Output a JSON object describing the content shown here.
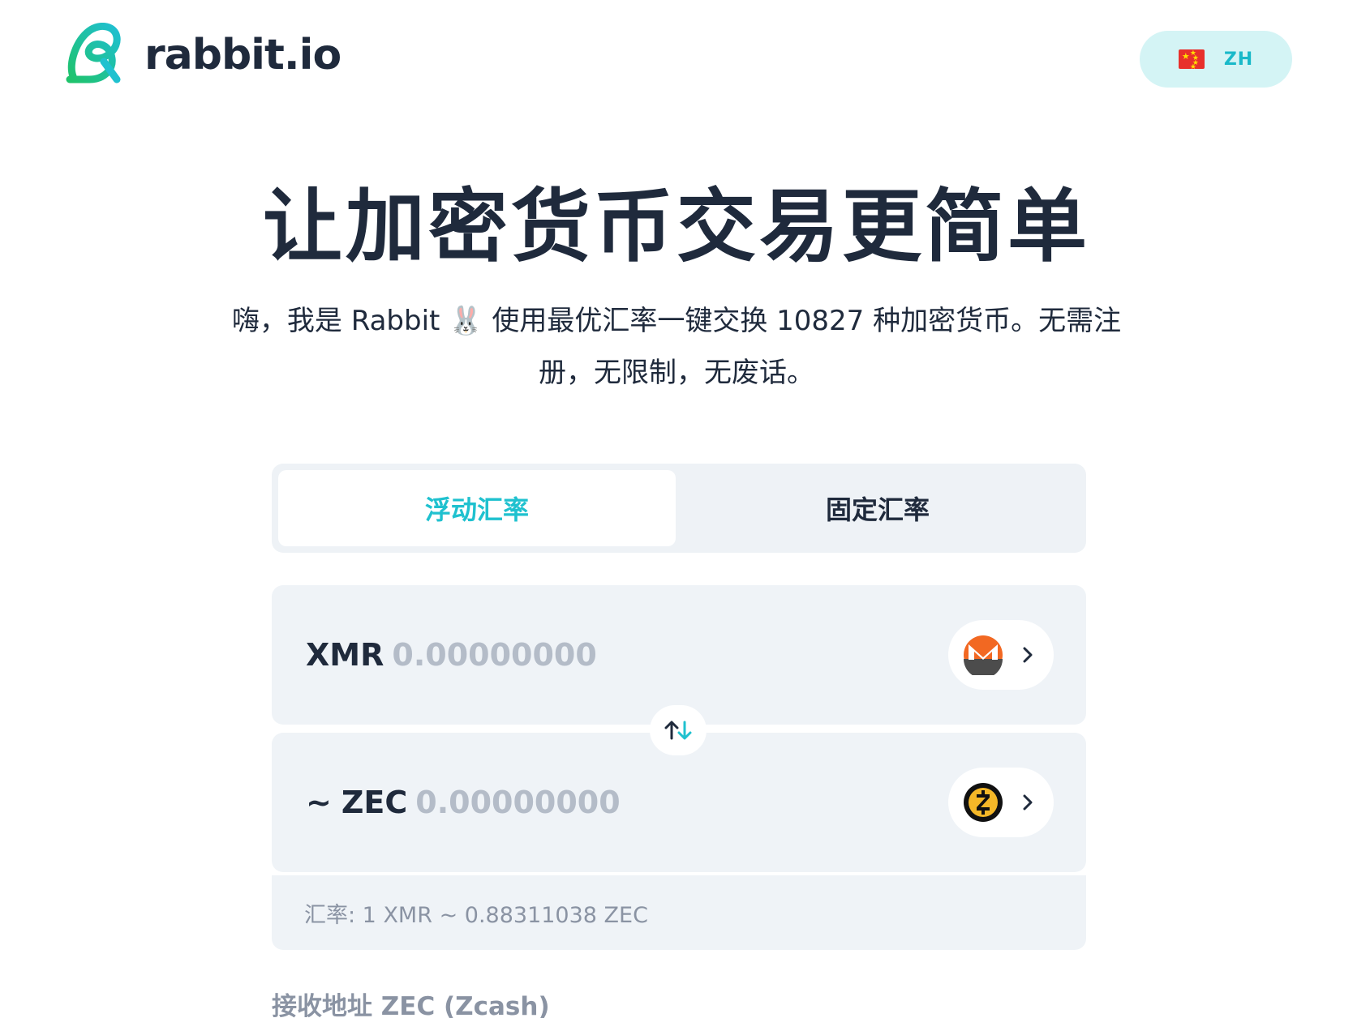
{
  "header": {
    "logo_text": "rabbit.io",
    "language": {
      "code": "ZH",
      "flag": "china-flag-icon"
    }
  },
  "hero": {
    "title": "让加密货币交易更简单",
    "subtitle": "嗨，我是 Rabbit 🐰 使用最优汇率一键交换 10827 种加密货币。无需注册，无限制，无废话。"
  },
  "rate_tabs": {
    "floating": "浮动汇率",
    "fixed": "固定汇率",
    "active": "floating"
  },
  "exchange": {
    "from": {
      "ticker": "XMR",
      "amount_placeholder": "0.00000000",
      "icon": "monero-icon"
    },
    "to": {
      "prefix": "~",
      "ticker": "ZEC",
      "amount_placeholder": "0.00000000",
      "icon": "zcash-icon"
    },
    "rate_text": "汇率: 1 XMR ~ 0.88311038 ZEC"
  },
  "receive": {
    "label": "接收地址 ZEC (Zcash)"
  },
  "colors": {
    "accent": "#1fc1cf",
    "text": "#1f2a3c",
    "muted": "#8a93a3",
    "panel": "#eff3f7",
    "lang_bg": "#d4f4f5",
    "monero": "#f26822",
    "zcash": "#f4b728"
  }
}
